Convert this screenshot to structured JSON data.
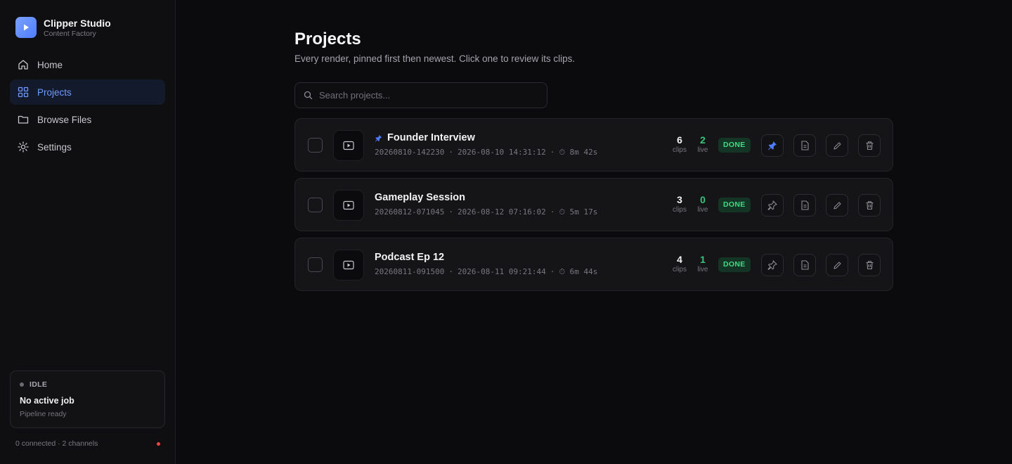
{
  "app": {
    "name": "Clipper Studio",
    "subtitle": "Content Factory",
    "logo_icon": "play-icon",
    "accent": "#4f7dff"
  },
  "sidebar": {
    "items": [
      {
        "label": "Home",
        "icon": "home-icon",
        "active": false
      },
      {
        "label": "Projects",
        "icon": "grid-icon",
        "active": true
      },
      {
        "label": "Browse Files",
        "icon": "folder-icon",
        "active": false
      },
      {
        "label": "Settings",
        "icon": "gear-icon",
        "active": false
      }
    ],
    "job": {
      "status": "IDLE",
      "title": "No active job",
      "subtitle": "Pipeline ready"
    },
    "footer": {
      "connection": "0 connected · 2 channels",
      "status_color": "#ef4444"
    }
  },
  "main": {
    "title": "Projects",
    "subtitle": "Every render, pinned first then newest. Click one to review its clips.",
    "search": {
      "placeholder": "Search projects...",
      "value": ""
    },
    "projects": [
      {
        "name": "Founder Interview",
        "pinned": true,
        "id": "20260810-142230",
        "datetime": "2026-08-10 14:31:12",
        "duration": "8m 42s",
        "clips": "6",
        "clips_label": "clips",
        "live": "2",
        "live_label": "live",
        "status": "DONE"
      },
      {
        "name": "Gameplay Session",
        "pinned": false,
        "id": "20260812-071045",
        "datetime": "2026-08-12 07:16:02",
        "duration": "5m 17s",
        "clips": "3",
        "clips_label": "clips",
        "live": "0",
        "live_label": "live",
        "status": "DONE"
      },
      {
        "name": "Podcast Ep 12",
        "pinned": false,
        "id": "20260811-091500",
        "datetime": "2026-08-11 09:21:44",
        "duration": "6m 44s",
        "clips": "4",
        "clips_label": "clips",
        "live": "1",
        "live_label": "live",
        "status": "DONE"
      }
    ],
    "colors": {
      "done_badge_bg": "#143525",
      "done_badge_text": "#3ddc84",
      "live_count": "#34c77b",
      "pinned_icon": "#4f7dff"
    }
  }
}
